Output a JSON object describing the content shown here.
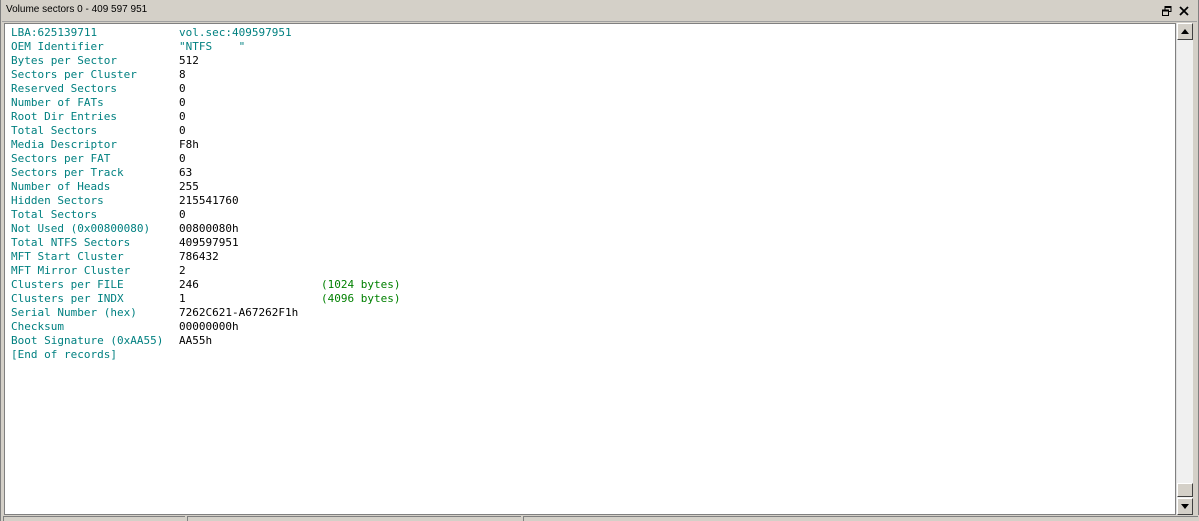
{
  "window": {
    "title": "Volume sectors 0 - 409 597 951"
  },
  "header": {
    "lba": "LBA:625139711",
    "vol_sec": "vol.sec:409597951"
  },
  "records": [
    {
      "label": "OEM Identifier",
      "value": "\"NTFS    \"",
      "note": ""
    },
    {
      "label": "Bytes per Sector",
      "value": "512",
      "note": ""
    },
    {
      "label": "Sectors per Cluster",
      "value": "8",
      "note": ""
    },
    {
      "label": "Reserved Sectors",
      "value": "0",
      "note": ""
    },
    {
      "label": "Number of FATs",
      "value": "0",
      "note": ""
    },
    {
      "label": "Root Dir Entries",
      "value": "0",
      "note": ""
    },
    {
      "label": "Total Sectors",
      "value": "0",
      "note": ""
    },
    {
      "label": "Media Descriptor",
      "value": "F8h",
      "note": ""
    },
    {
      "label": "Sectors per FAT",
      "value": "0",
      "note": ""
    },
    {
      "label": "Sectors per Track",
      "value": "63",
      "note": ""
    },
    {
      "label": "Number of Heads",
      "value": "255",
      "note": ""
    },
    {
      "label": "Hidden Sectors",
      "value": "215541760",
      "note": ""
    },
    {
      "label": "Total Sectors",
      "value": "0",
      "note": ""
    },
    {
      "label": "Not Used (0x00800080)",
      "value": "00800080h",
      "note": ""
    },
    {
      "label": "Total NTFS Sectors",
      "value": "409597951",
      "note": ""
    },
    {
      "label": "MFT Start Cluster",
      "value": "786432",
      "note": ""
    },
    {
      "label": "MFT Mirror Cluster",
      "value": "2",
      "note": ""
    },
    {
      "label": "Clusters per FILE",
      "value": "246",
      "note": "(1024 bytes)"
    },
    {
      "label": "Clusters per INDX",
      "value": "1",
      "note": "(4096 bytes)"
    },
    {
      "label": "Serial Number (hex)",
      "value": "7262C621-A67262F1h",
      "note": ""
    },
    {
      "label": "Checksum",
      "value": "00000000h",
      "note": ""
    },
    {
      "label": "Boot Signature (0xAA55)",
      "value": "AA55h",
      "note": ""
    }
  ],
  "end_marker": "[End of records]",
  "icons": {
    "restore": "restore-icon",
    "close": "close-icon",
    "scroll_up": "arrow-up-icon",
    "scroll_down": "arrow-down-icon"
  },
  "colors": {
    "label": "#008080",
    "value": "#000000",
    "note": "#008000",
    "background": "#ffffff",
    "chrome": "#d4d0c8"
  }
}
